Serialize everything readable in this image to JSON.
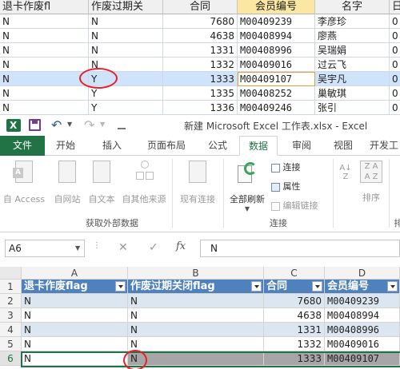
{
  "top_grid": {
    "headers": [
      "退卡作废fl",
      "作废过期关",
      "合同",
      "会员编号",
      "名字",
      "日"
    ],
    "rows": [
      [
        "N",
        "N",
        "7680",
        "M00409239",
        "李彦珍",
        "0"
      ],
      [
        "N",
        "N",
        "4638",
        "M00408994",
        "廖燕",
        "0"
      ],
      [
        "N",
        "N",
        "1331",
        "M00408996",
        "吴瑞娟",
        "0"
      ],
      [
        "N",
        "N",
        "1332",
        "M00409016",
        "过云飞",
        "0"
      ],
      [
        "N",
        "Y",
        "1333",
        "M00409107",
        "吴宇凡",
        "0"
      ],
      [
        "N",
        "Y",
        "1335",
        "M00408252",
        "巢敏琪",
        "0"
      ],
      [
        "N",
        "Y",
        "1336",
        "M00409246",
        "张引",
        "0"
      ]
    ]
  },
  "window": {
    "title": "新建 Microsoft Excel 工作表.xlsx - Excel",
    "app_icon": "excel-logo-icon"
  },
  "ribbon_tabs": [
    "文件",
    "开始",
    "插入",
    "页面布局",
    "公式",
    "数据",
    "审阅",
    "视图",
    "开发工"
  ],
  "ribbon": {
    "get_external": [
      "自 Access",
      "自网站",
      "自文本",
      "自其他来源",
      "现有连接"
    ],
    "get_external_label": "获取外部数据",
    "refresh_all": "全部刷新",
    "conn_items": [
      "连接",
      "属性",
      "编辑链接"
    ],
    "conn_label": "连接",
    "sort_label": "排序",
    "sort_group_label": "排"
  },
  "formula_bar": {
    "name_box": "A6",
    "fx": "fx",
    "value": "N"
  },
  "sheet": {
    "columns": [
      "A",
      "B",
      "C",
      "D"
    ],
    "row_numbers": [
      "1",
      "2",
      "3",
      "4",
      "5",
      "6"
    ],
    "header": [
      "退卡作废flag",
      "作废过期关闭flag",
      "合同",
      "会员编号"
    ],
    "rows": [
      [
        "N",
        "N",
        "7680",
        "M00409239"
      ],
      [
        "N",
        "N",
        "4638",
        "M00408994"
      ],
      [
        "N",
        "N",
        "1331",
        "M00408996"
      ],
      [
        "N",
        "N",
        "1332",
        "M00409016"
      ],
      [
        "N",
        "N",
        "1333",
        "M00409107"
      ]
    ]
  },
  "colors": {
    "excel_green": "#217346",
    "table_header": "#4f81bd",
    "band": "#dce6f1",
    "highlight": "#e8202a"
  }
}
